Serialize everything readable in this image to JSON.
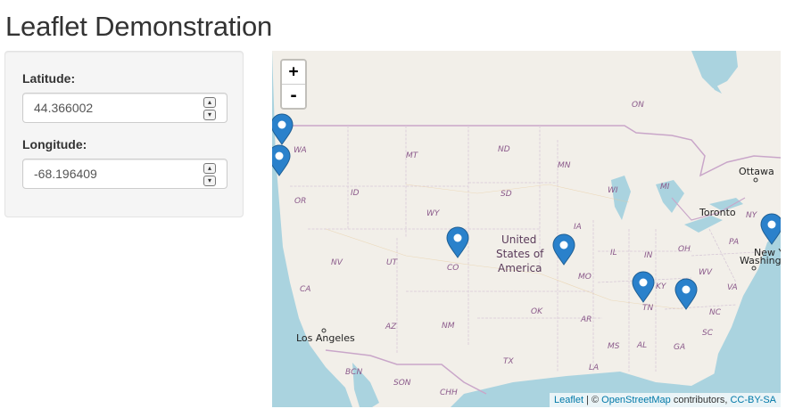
{
  "page": {
    "title": "Leaflet Demonstration"
  },
  "sidebar": {
    "latitude": {
      "label": "Latitude:",
      "value": "44.366002"
    },
    "longitude": {
      "label": "Longitude:",
      "value": "-68.196409"
    }
  },
  "map": {
    "zoom_in": "+",
    "zoom_out": "-",
    "attribution": {
      "leaflet": "Leaflet",
      "sep1": " | © ",
      "osm": "OpenStreetMap",
      "contributors": " contributors, ",
      "license": "CC-BY-SA"
    },
    "country_label": [
      "United",
      "States of",
      "America"
    ],
    "cities": [
      "Ottawa",
      "Toronto",
      "Washington",
      "New Yo",
      "Los Angeles"
    ],
    "states": [
      "WA",
      "OR",
      "CA",
      "NV",
      "ID",
      "MT",
      "WY",
      "UT",
      "AZ",
      "CO",
      "NM",
      "ND",
      "SD",
      "MN",
      "IA",
      "MO",
      "OK",
      "TX",
      "AR",
      "LA",
      "WI",
      "MI",
      "IL",
      "IN",
      "OH",
      "KY",
      "TN",
      "MS",
      "AL",
      "GA",
      "NC",
      "VA",
      "WV",
      "PA",
      "NY",
      "SC",
      "ON",
      "BCN",
      "SON",
      "CHH"
    ],
    "marker_color": "#2a81cb",
    "water_color": "#aad3df",
    "land_color": "#f2efe9"
  }
}
